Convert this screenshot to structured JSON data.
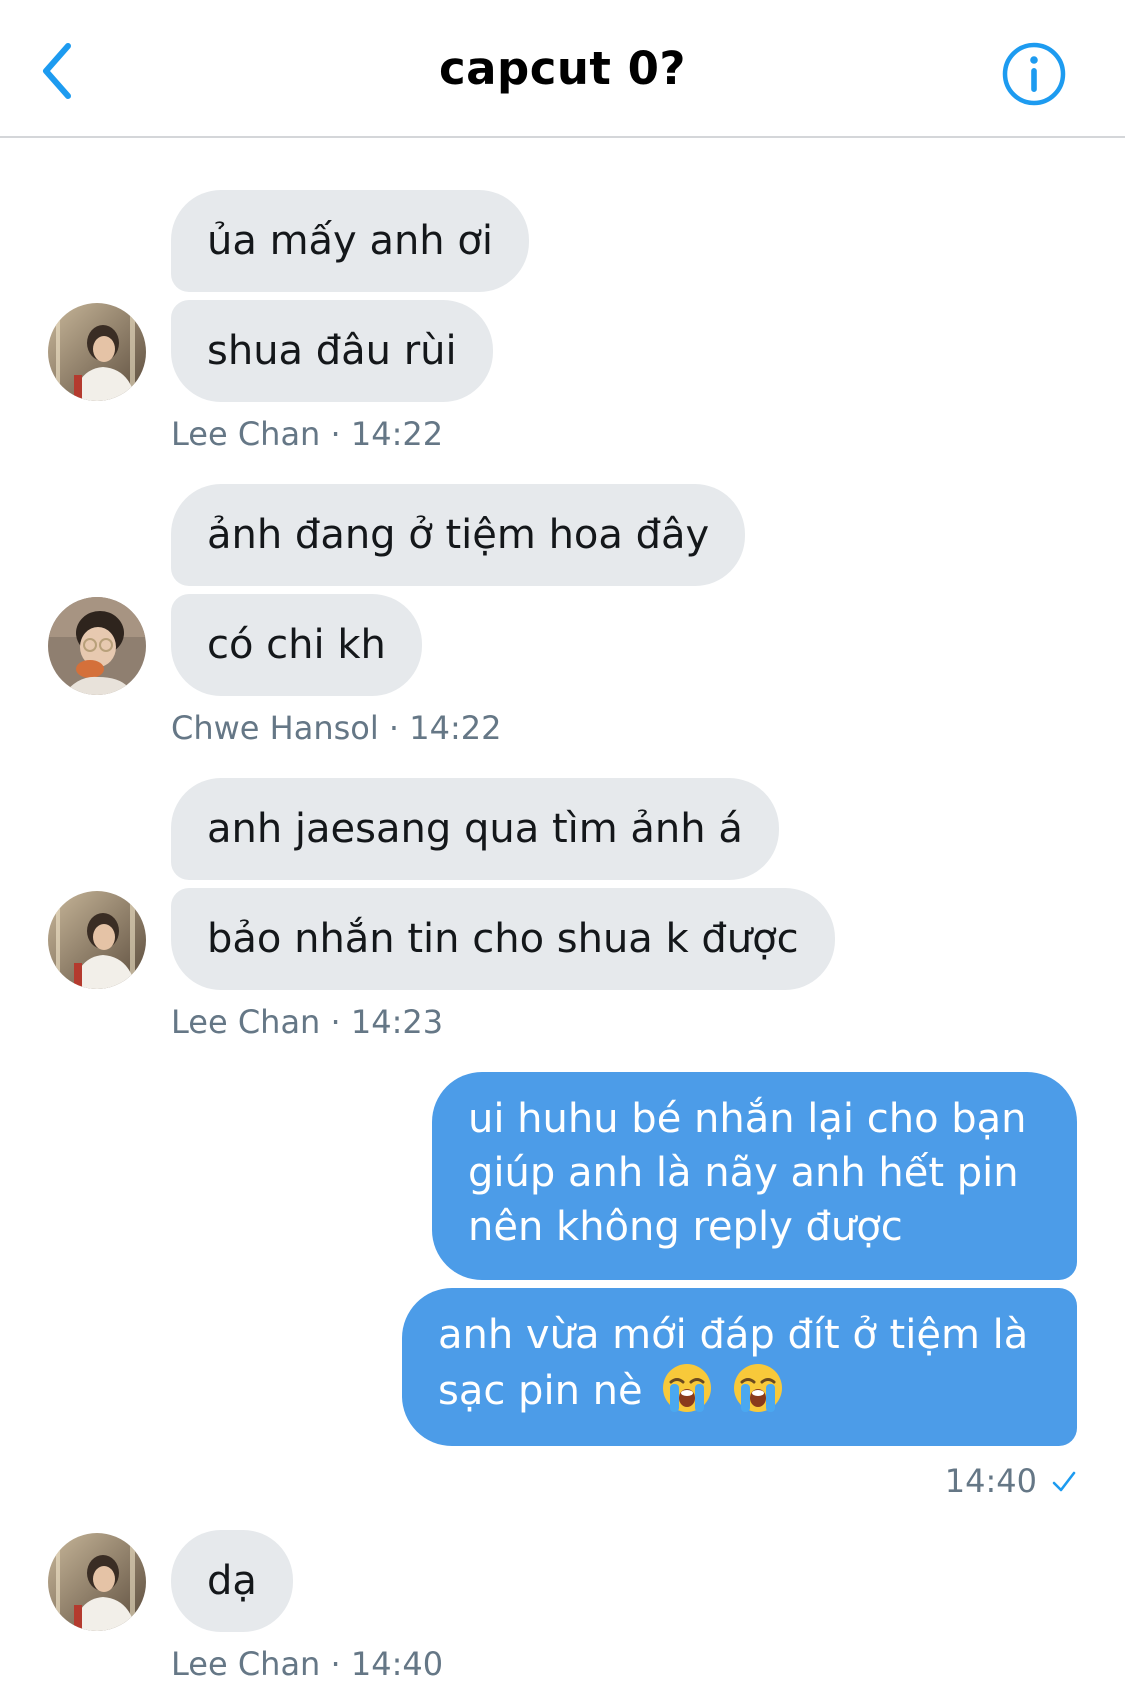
{
  "header": {
    "title": "capcut 0?"
  },
  "colors": {
    "accent": "#4c9ce8",
    "incoming_bubble": "#e6e9ec",
    "meta_text": "#657786"
  },
  "messages": [
    {
      "sender": "Lee Chan",
      "time": "14:22",
      "meta": "Lee Chan · 14:22",
      "lines": [
        "ủa mấy anh ơi",
        "shua đâu rùi"
      ]
    },
    {
      "sender": "Chwe Hansol",
      "time": "14:22",
      "meta": "Chwe Hansol · 14:22",
      "lines": [
        "ảnh đang ở tiệm hoa đây",
        "có chi kh"
      ]
    },
    {
      "sender": "Lee Chan",
      "time": "14:23",
      "meta": "Lee Chan · 14:23",
      "lines": [
        "anh jaesang qua tìm ảnh á",
        "bảo nhắn tin cho shua k được"
      ]
    },
    {
      "sender": "me",
      "time": "14:40",
      "lines": [
        "ui huhu bé nhắn lại cho bạn giúp anh là nãy anh hết pin nên không reply được",
        "anh vừa mới đáp đít ở tiệm là sạc pin nè"
      ],
      "emoji": [
        "loudly-crying-face",
        "loudly-crying-face"
      ],
      "status": "sent"
    },
    {
      "sender": "Lee Chan",
      "time": "14:40",
      "meta": "Lee Chan · 14:40",
      "lines": [
        "dạ"
      ]
    }
  ]
}
